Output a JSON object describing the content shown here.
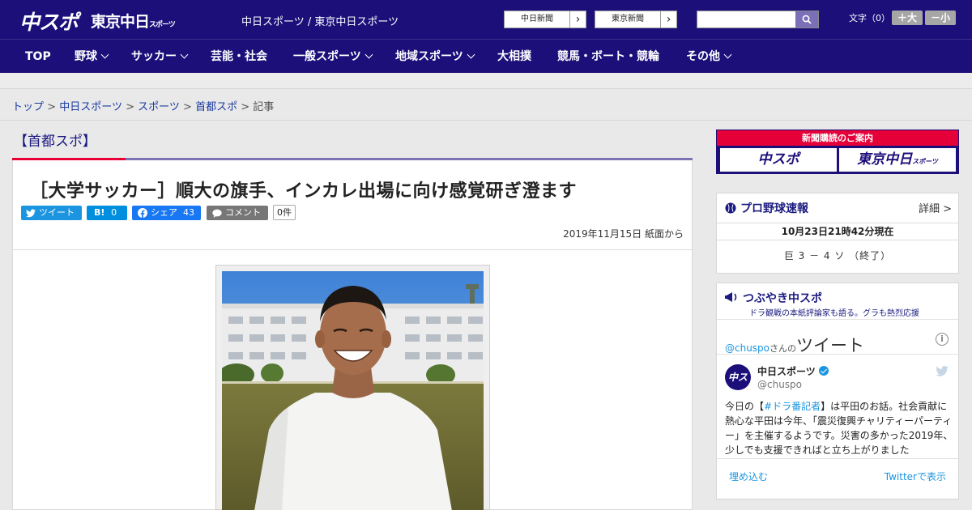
{
  "header": {
    "logo_main": "中スポ",
    "logo_sub": "東京中日",
    "logo_sub_small": "スポーツ",
    "site_title": "中日スポーツ / 東京中日スポーツ",
    "paper_buttons": [
      {
        "label": "中日新聞",
        "arrow": "›"
      },
      {
        "label": "東京新聞",
        "arrow": "›"
      }
    ],
    "search": {
      "value": "",
      "placeholder": ""
    },
    "font_size_label": "文字（0）",
    "font_plus": "＋大",
    "font_minus": "－小"
  },
  "nav": {
    "items": [
      {
        "label": "TOP"
      },
      {
        "label": "野球"
      },
      {
        "label": "サッカー"
      },
      {
        "label": "芸能・社会"
      },
      {
        "label": "一般スポーツ"
      },
      {
        "label": "地域スポーツ"
      },
      {
        "label": "大相撲"
      },
      {
        "label": "競馬・ボート・競輪"
      },
      {
        "label": "その他"
      }
    ]
  },
  "breadcrumb": {
    "items": [
      "トップ",
      "中日スポーツ",
      "スポーツ",
      "首都スポ"
    ],
    "current": "記事",
    "separator": ">"
  },
  "article": {
    "category": "【首都スポ】",
    "headline": "［大学サッカー］順大の旗手、インカレ出場に向け感覚研ぎ澄ます",
    "share": {
      "tweet": "ツイート",
      "hatena_label": "B!",
      "hatena_count": "0",
      "facebook": "シェア",
      "facebook_count": "43",
      "comment": "コメント",
      "comment_count": "0件"
    },
    "date": "2019年11月15日 紙面から"
  },
  "sidebar": {
    "subscribe": {
      "title": "新聞購読のご案内",
      "btn1": "中スポ",
      "btn2": "東京中日",
      "btn2_small": "スポーツ"
    },
    "baseball": {
      "title": "プロ野球速報",
      "detail": "詳細 >",
      "timestamp": "10月23日21時42分現在",
      "score": "巨 3 － 4 ソ （終了）"
    },
    "tweets": {
      "title": "つぶやき中スポ",
      "subtitle": "ドラ観戦の本紙評論家も語る。グラも熱烈応援",
      "handle": "@chuspo",
      "handle_suffix": "さんの",
      "heading": "ツイート",
      "info": "i",
      "avatar_text": "中スポ",
      "name": "中日スポーツ",
      "at": "@chuspo",
      "text_before": "今日の【",
      "hashtag": "#ドラ番記者",
      "text_after": "】は平田のお話。社会貢献に熱心な平田は今年、「震災復興チャリティーパーティー」を主催するようです。災害の多かった2019年、少しでも支援できればと立ち上がりました",
      "embed": "埋め込む",
      "view_on_twitter": "Twitterで表示"
    }
  }
}
